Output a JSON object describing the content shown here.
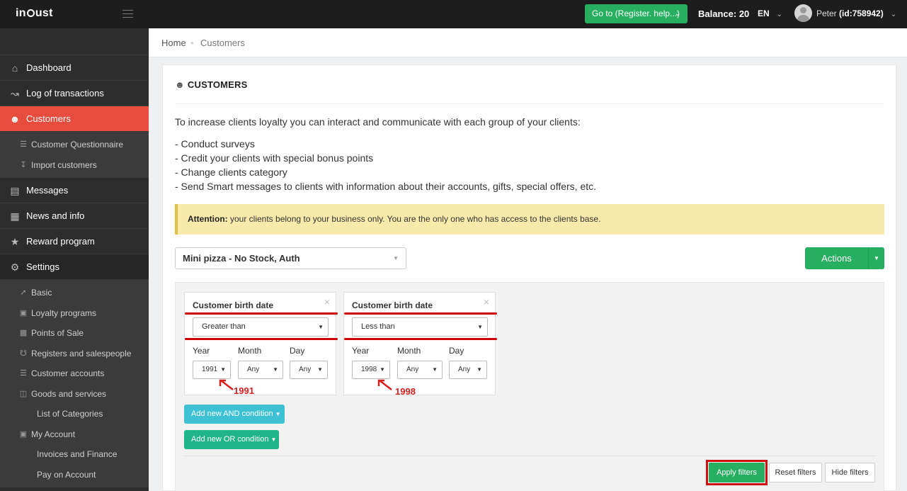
{
  "topbar": {
    "logo": "incust",
    "goto_label": "Go to (Register. help...)",
    "balance_label": "Balance:",
    "balance_value": "20",
    "lang": "EN",
    "user_name": "Peter",
    "user_id": "(id:758942)"
  },
  "sidebar": {
    "items": [
      {
        "label": "Dashboard",
        "icon": "home-icon"
      },
      {
        "label": "Log of transactions",
        "icon": "trend-icon"
      },
      {
        "label": "Customers",
        "icon": "users-icon"
      },
      {
        "label": "Customer Questionnaire",
        "icon": "list-icon"
      },
      {
        "label": "Import customers",
        "icon": "download-icon"
      },
      {
        "label": "Messages",
        "icon": "message-icon"
      },
      {
        "label": "News and info",
        "icon": "newspaper-icon"
      },
      {
        "label": "Reward program",
        "icon": "star-icon"
      },
      {
        "label": "Settings",
        "icon": "gear-icon"
      },
      {
        "label": "Basic",
        "icon": "rocket-icon"
      },
      {
        "label": "Loyalty programs",
        "icon": "document-icon"
      },
      {
        "label": "Points of Sale",
        "icon": "building-icon"
      },
      {
        "label": "Registers and salespeople",
        "icon": "cart-icon"
      },
      {
        "label": "Customer accounts",
        "icon": "list-icon"
      },
      {
        "label": "Goods and services",
        "icon": "gift-icon"
      },
      {
        "label": "List of Categories",
        "icon": ""
      },
      {
        "label": "My Account",
        "icon": "money-icon"
      },
      {
        "label": "Invoices and Finance",
        "icon": ""
      },
      {
        "label": "Pay on Account",
        "icon": ""
      }
    ]
  },
  "breadcrumb": {
    "home": "Home",
    "sep": "•",
    "current": "Customers"
  },
  "card": {
    "title": "CUSTOMERS",
    "intro": "To increase clients loyalty you can interact and communicate with each group of your clients:",
    "bullets": [
      "- Conduct surveys",
      "- Credit your clients with special bonus points",
      "- Change clients category",
      "- Send Smart messages to clients with information about their accounts, gifts, special offers, etc."
    ],
    "attention_label": "Attention:",
    "attention_text": " your clients belong to your business only. You are the only one who has access to the clients base.",
    "store_select": "Mini pizza - No Stock, Auth",
    "actions_label": "Actions"
  },
  "filters": [
    {
      "title": "Customer birth date",
      "operator": "Greater than",
      "year_label": "Year",
      "month_label": "Month",
      "day_label": "Day",
      "year_value": "1991",
      "month_value": "Any",
      "day_value": "Any",
      "annotation": "1991"
    },
    {
      "title": "Customer birth date",
      "operator": "Less than",
      "year_label": "Year",
      "month_label": "Month",
      "day_label": "Day",
      "year_value": "1998",
      "month_value": "Any",
      "day_value": "Any",
      "annotation": "1998"
    }
  ],
  "filter_buttons": {
    "and_label": "Add new AND condition",
    "or_label": "Add new OR condition",
    "apply": "Apply filters",
    "reset": "Reset filters",
    "hide": "Hide filters"
  },
  "colors": {
    "accent_red": "#e74c3c",
    "green": "#27ae60",
    "teal": "#3ec1d3",
    "annotation_red": "#d10f0f",
    "attention_bg": "#f9eaac"
  }
}
